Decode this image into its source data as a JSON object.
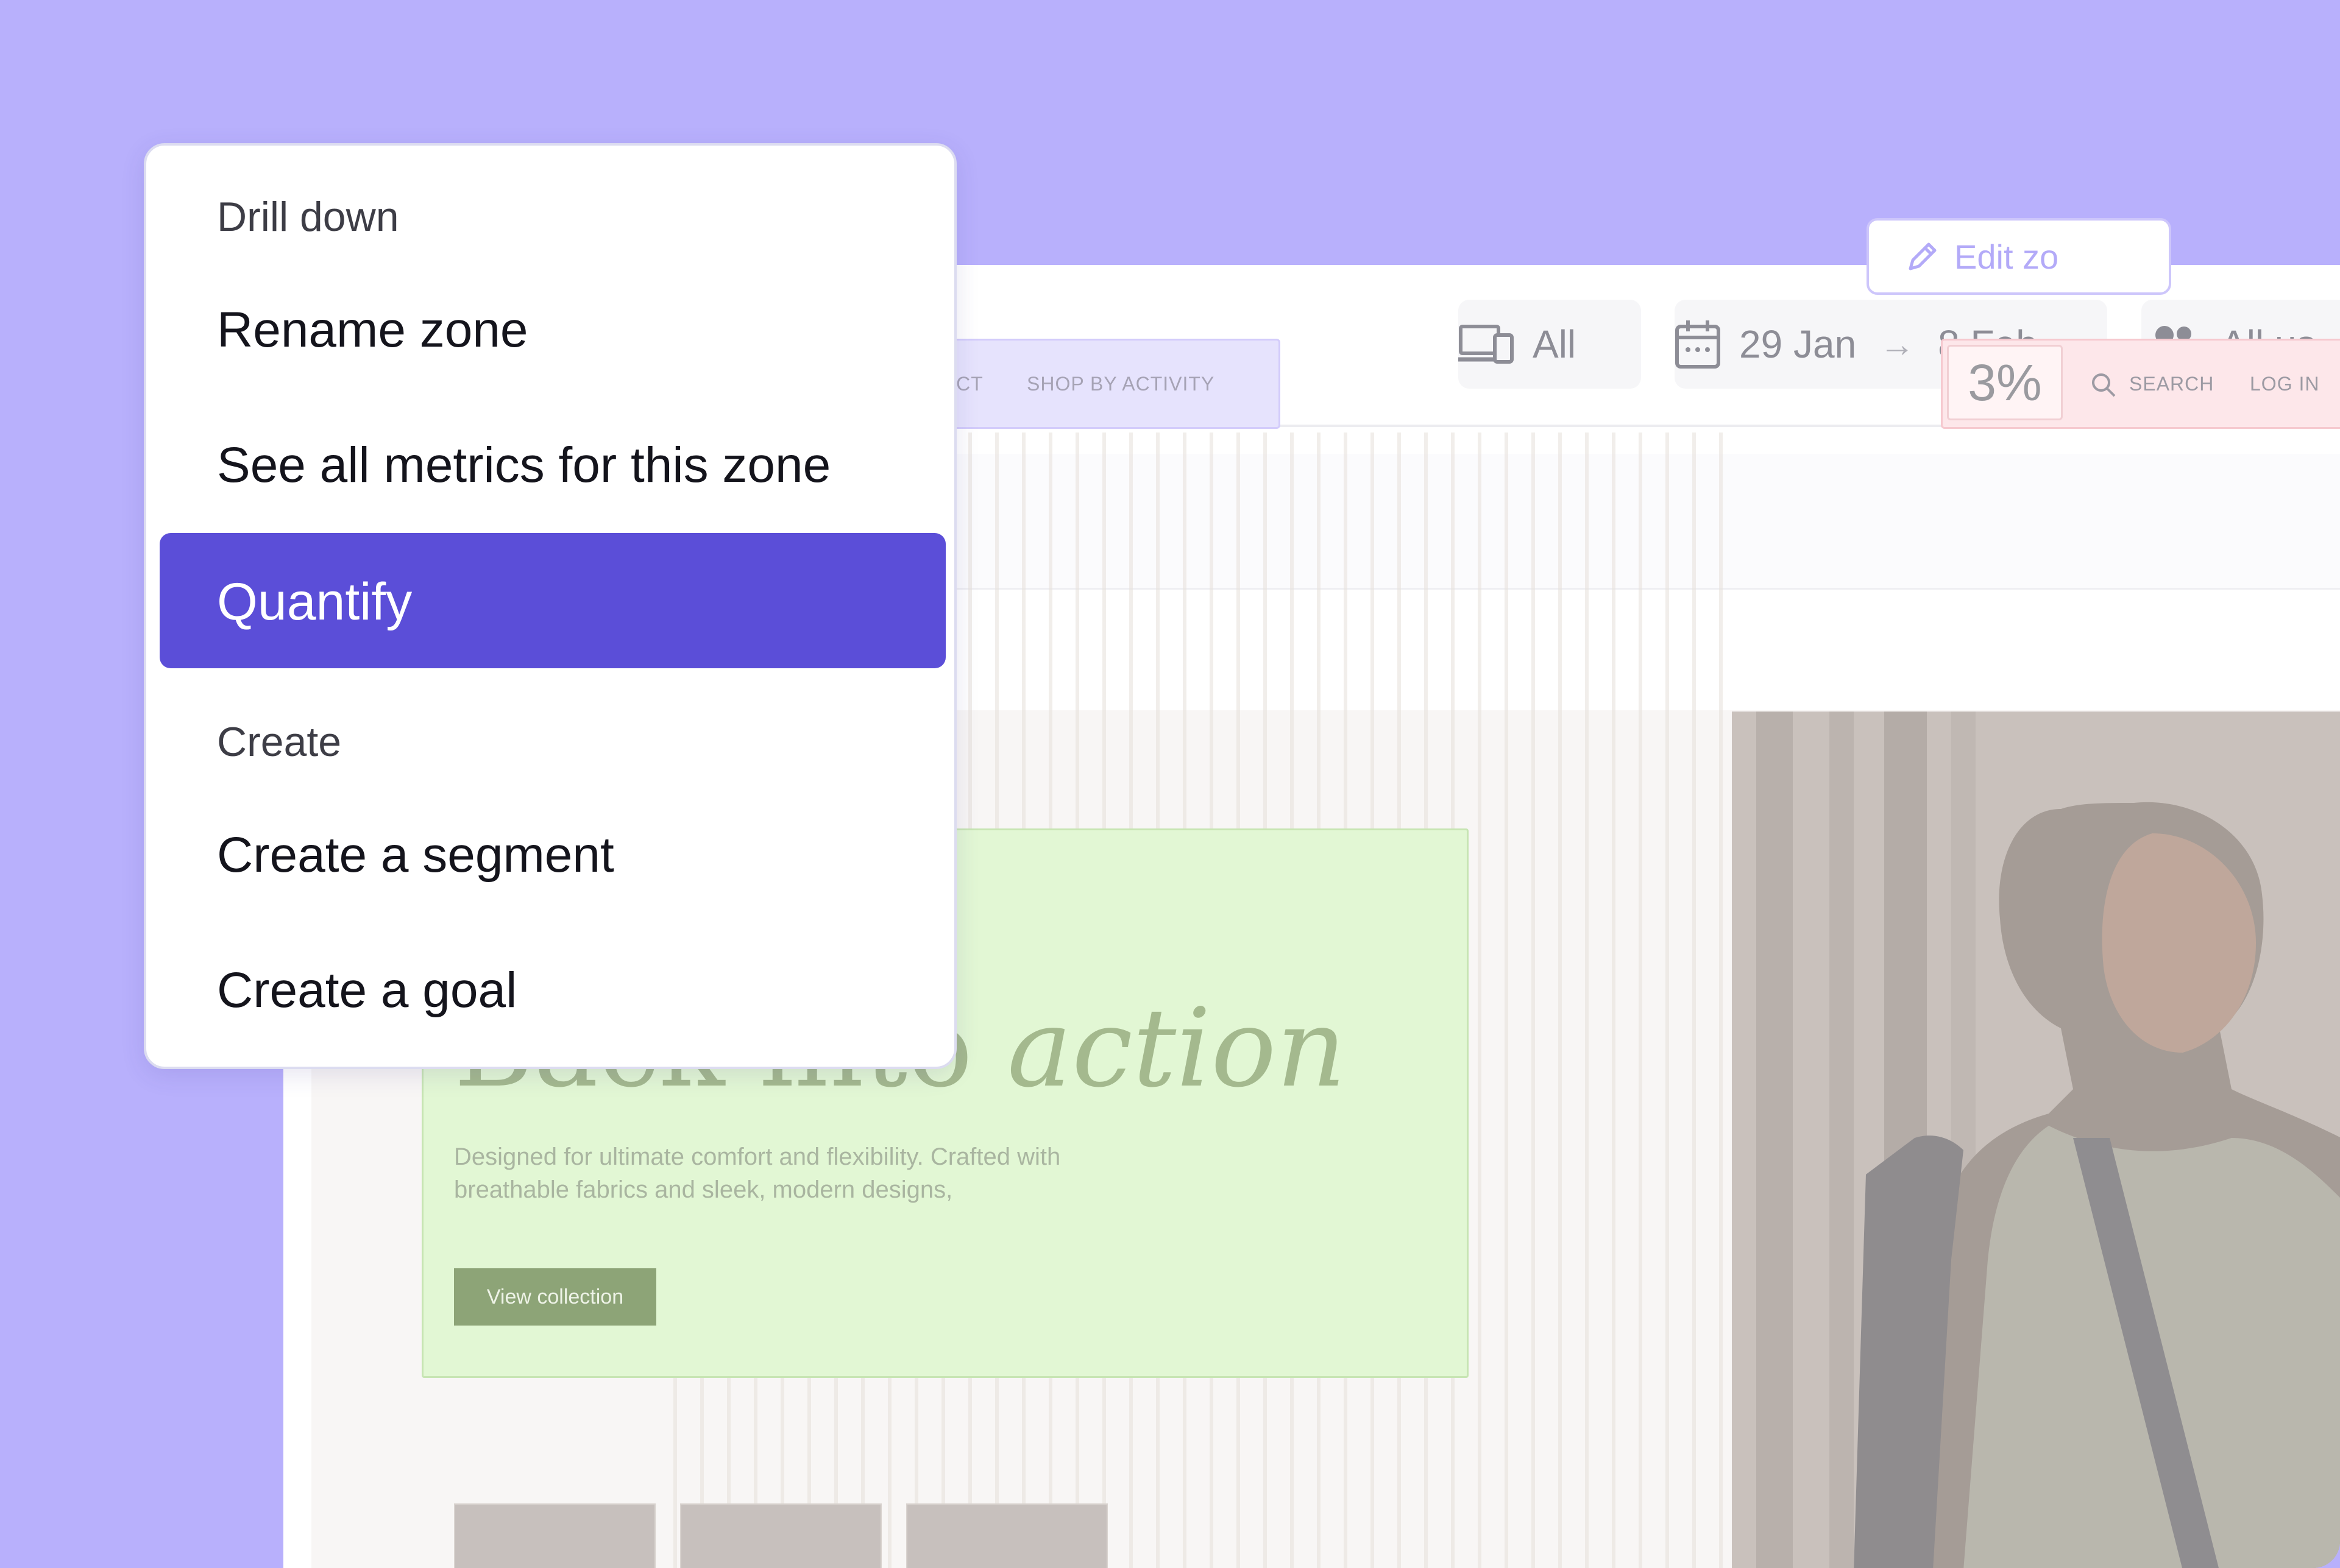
{
  "topbar": {
    "device_filter": "All",
    "date_start": "29 Jan",
    "date_arrow": "→",
    "date_end": "8 Feb",
    "users_filter": "All us"
  },
  "zonebar": {
    "edit_label": "Edit zo"
  },
  "site": {
    "nav_partial": "UCT",
    "nav_activity": "SHOP BY ACTIVITY",
    "metric_percent": "3%",
    "search_label": "SEARCH",
    "login_label": "LOG IN",
    "hero_title_regular": "Back into",
    "hero_title_italic": "action",
    "hero_desc": "Designed for ultimate comfort and flexibility. Crafted with breathable fabrics and sleek, modern designs,",
    "hero_button": "View collection"
  },
  "menu": {
    "section_drill": "Drill down",
    "rename": "Rename zone",
    "see_all": "See all metrics for this zone",
    "quantify": "Quantify",
    "section_create": "Create",
    "create_segment": "Create a segment",
    "create_goal": "Create a goal"
  },
  "colors": {
    "background": "#b8b0fc",
    "menu_active": "#5b4ed8",
    "hero_zone": "#e2f7d4",
    "nav_zone_purple": "#e6e3fd",
    "nav_zone_pink": "#fde7ea"
  },
  "icons": [
    "devices-icon",
    "calendar-icon",
    "users-icon",
    "pencil-icon",
    "search-icon"
  ]
}
